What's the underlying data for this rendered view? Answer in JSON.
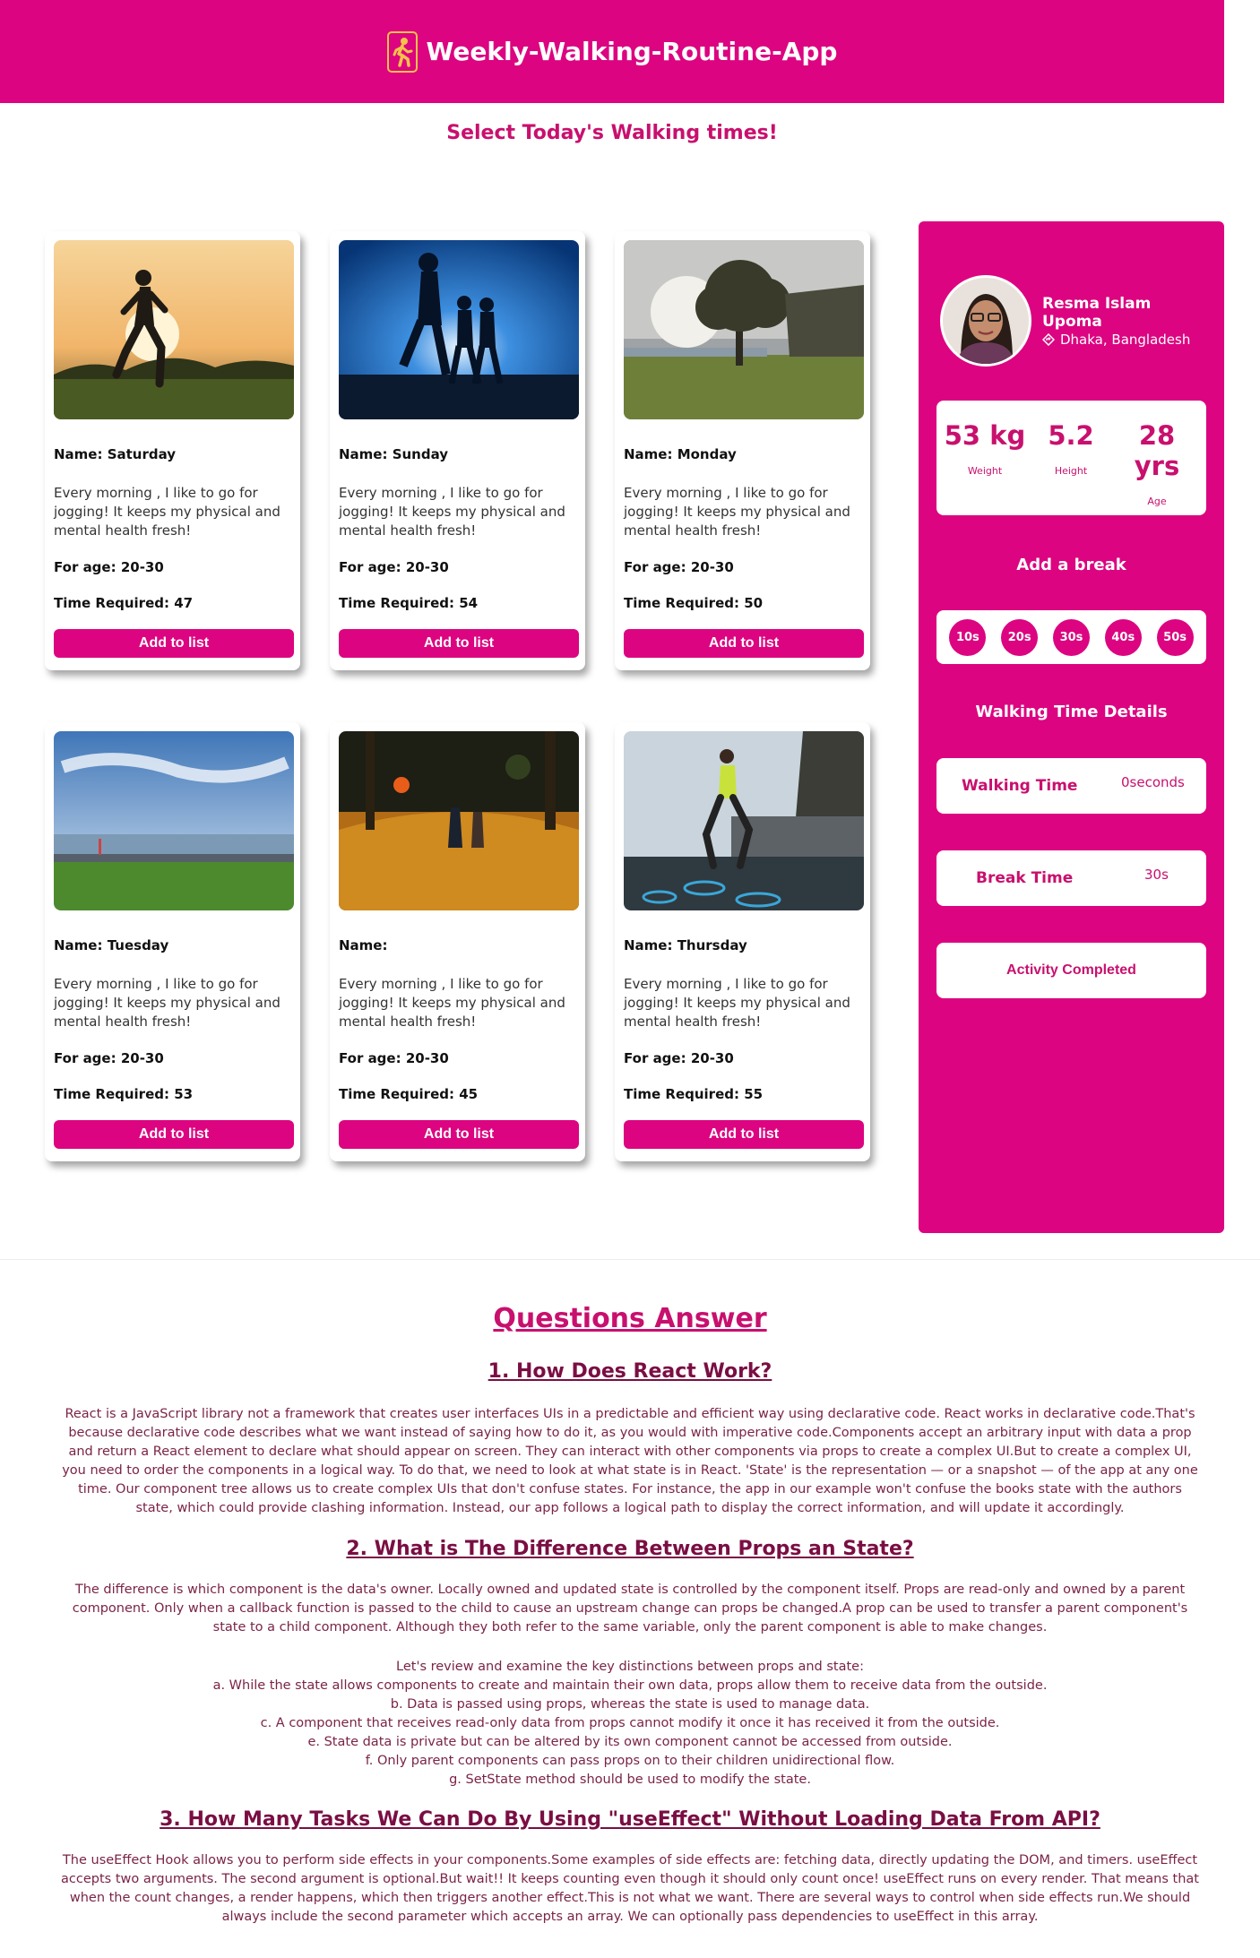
{
  "header": {
    "title": "Weekly-Walking-Routine-App",
    "icon": "walking-person-icon",
    "brand_color": "#dc0480"
  },
  "subtitle": "Select Today's Walking times!",
  "cards": [
    {
      "name": "Name: Saturday",
      "desc": "Every morning , I like to go for jogging! It keeps my physical and mental health fresh!",
      "age": "For age: 20-30",
      "time": "Time Required: 47",
      "button": "Add to list"
    },
    {
      "name": "Name: Sunday",
      "desc": "Every morning , I like to go for jogging! It keeps my physical and mental health fresh!",
      "age": "For age: 20-30",
      "time": "Time Required: 54",
      "button": "Add to list"
    },
    {
      "name": "Name: Monday",
      "desc": "Every morning , I like to go for jogging! It keeps my physical and mental health fresh!",
      "age": "For age: 20-30",
      "time": "Time Required: 50",
      "button": "Add to list"
    },
    {
      "name": "Name: Tuesday",
      "desc": "Every morning , I like to go for jogging! It keeps my physical and mental health fresh!",
      "age": "For age: 20-30",
      "time": "Time Required: 53",
      "button": "Add to list"
    },
    {
      "name": "Name:",
      "desc": "Every morning , I like to go for jogging! It keeps my physical and mental health fresh!",
      "age": "For age: 20-30",
      "time": "Time Required: 45",
      "button": "Add to list"
    },
    {
      "name": "Name: Thursday",
      "desc": "Every morning , I like to go for jogging! It keeps my physical and mental health fresh!",
      "age": "For age: 20-30",
      "time": "Time Required: 55",
      "button": "Add to list"
    }
  ],
  "sidebar": {
    "name": "Resma Islam Upoma",
    "location": "Dhaka, Bangladesh",
    "stats": [
      {
        "value": "53 kg",
        "label": "Weight"
      },
      {
        "value": "5.2",
        "label": "Height"
      },
      {
        "value": "28 yrs",
        "label": "Age"
      }
    ],
    "break_title": "Add a break",
    "breaks": [
      "10s",
      "20s",
      "30s",
      "40s",
      "50s"
    ],
    "details_title": "Walking Time Details",
    "walking_label": "Walking Time",
    "walking_value": "0seconds",
    "break_label": "Break Time",
    "break_value": "30s",
    "complete_button": "Activity Completed"
  },
  "qa": {
    "title": "Questions Answer",
    "q1": "1. How Does React Work?",
    "a1": "React is a JavaScript library not a framework that creates user interfaces UIs in a predictable and efficient way using declarative code. React works in declarative code.That's because declarative code describes what we want instead of saying how to do it, as you would with imperative code.Components accept an arbitrary input with data a prop and return a React element to declare what should appear on screen. They can interact with other components via props to create a complex UI.But to create a complex UI, you need to order the components in a logical way. To do that, we need to look at what state is in React. 'State' is the representation — or a snapshot — of the app at any one time. Our component tree allows us to create complex UIs that don't confuse states. For instance, the app in our example won't confuse the books state with the authors state, which could provide clashing information. Instead, our app follows a logical path to display the correct information, and will update it accordingly.",
    "q2": "2. What is The Difference Between Props an State?",
    "a2": "The difference is which component is the data's owner. Locally owned and updated state is controlled by the component itself. Props are read-only and owned by a parent component. Only when a callback function is passed to the child to cause an upstream change can props be changed.A prop can be used to transfer a parent component's state to a child component. Although they both refer to the same variable, only the parent component is able to make changes.",
    "a2_list": [
      "Let's review and examine the key distinctions between props and state:",
      "a. While the state allows components to create and maintain their own data, props allow them to receive data from the outside.",
      "b. Data is passed using props, whereas the state is used to manage data.",
      "c. A component that receives read-only data from props cannot modify it once it has received it from the outside.",
      "e. State data is private but can be altered by its own component cannot be accessed from outside.",
      "f. Only parent components can pass props on to their children unidirectional flow.",
      "g. SetState method should be used to modify the state."
    ],
    "q3": "3. How Many Tasks We Can Do By Using \"useEffect\" Without Loading Data From API?",
    "a3": "The useEffect Hook allows you to perform side effects in your components.Some examples of side effects are: fetching data, directly updating the DOM, and timers. useEffect accepts two arguments. The second argument is optional.But wait!! It keeps counting even though it should only count once! useEffect runs on every render. That means that when the count changes, a render happens, which then triggers another effect.This is not what we want. There are several ways to control when side effects run.We should always include the second parameter which accepts an array. We can optionally pass dependencies to useEffect in this array."
  }
}
